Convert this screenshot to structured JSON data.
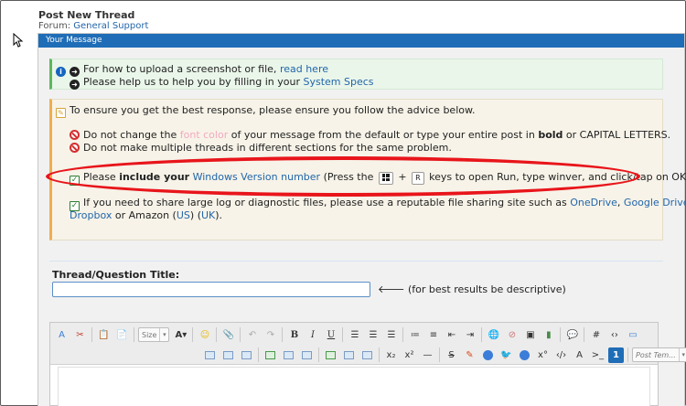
{
  "header": {
    "title": "Post New Thread",
    "forum_label": "Forum:",
    "forum_name": "General Support"
  },
  "panel": {
    "title": "Your Message"
  },
  "info": {
    "line1_prefix": "For how to upload a screenshot or file,",
    "line1_link": "read here",
    "line2_prefix": "Please help us to help you by filling in your",
    "line2_link": "System Specs"
  },
  "advice": {
    "intro": "To ensure you get the best response, please ensure you follow the advice below.",
    "rule1_a": "Do not change the",
    "rule1_font_color": "font color",
    "rule1_b": "of your message from the default or type your entire post in",
    "rule1_bold": "bold",
    "rule1_c": "or CAPITAL LETTERS.",
    "rule2": "Do not make multiple threads in different sections for the same problem.",
    "tip1_a": "Please",
    "tip1_bold": "include your",
    "tip1_link": "Windows Version number",
    "tip1_b": "(Press the",
    "tip1_plus": "+",
    "tip1_key_r": "R",
    "tip1_c": "keys to open Run, type winver, and click/tap on OK).",
    "tip2_a": "If you need to share large log or diagnostic files, please use a reputable file sharing site such as",
    "tip2_onedrive": "OneDrive",
    "tip2_comma1": ",",
    "tip2_gdrive": "Google Drive",
    "tip2_comma2": ",",
    "tip2_dropbox": "Dropbox",
    "tip2_or": "or Amazon (",
    "tip2_us": "US",
    "tip2_mid": ") (",
    "tip2_uk": "UK",
    "tip2_end": ")."
  },
  "thread": {
    "label": "Thread/Question Title:",
    "value": "",
    "hint": "(for best results be descriptive)",
    "hint_arrow": "🡐"
  },
  "toolbar": {
    "size_label": "Size",
    "post_template_label": "Post Tem..."
  },
  "colors": {
    "accent": "#1f6db7",
    "highlight": "#e8151b",
    "link": "#2266aa"
  }
}
